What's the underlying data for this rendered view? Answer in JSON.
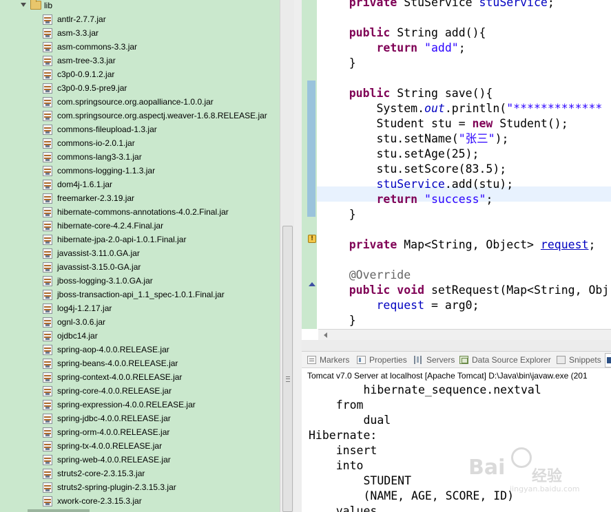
{
  "explorer": {
    "folder_label": "lib",
    "jars": [
      "antlr-2.7.7.jar",
      "asm-3.3.jar",
      "asm-commons-3.3.jar",
      "asm-tree-3.3.jar",
      "c3p0-0.9.1.2.jar",
      "c3p0-0.9.5-pre9.jar",
      "com.springsource.org.aopalliance-1.0.0.jar",
      "com.springsource.org.aspectj.weaver-1.6.8.RELEASE.jar",
      "commons-fileupload-1.3.jar",
      "commons-io-2.0.1.jar",
      "commons-lang3-3.1.jar",
      "commons-logging-1.1.3.jar",
      "dom4j-1.6.1.jar",
      "freemarker-2.3.19.jar",
      "hibernate-commons-annotations-4.0.2.Final.jar",
      "hibernate-core-4.2.4.Final.jar",
      "hibernate-jpa-2.0-api-1.0.1.Final.jar",
      "javassist-3.11.0.GA.jar",
      "javassist-3.15.0-GA.jar",
      "jboss-logging-3.1.0.GA.jar",
      "jboss-transaction-api_1.1_spec-1.0.1.Final.jar",
      "log4j-1.2.17.jar",
      "ognl-3.0.6.jar",
      "ojdbc14.jar",
      "spring-aop-4.0.0.RELEASE.jar",
      "spring-beans-4.0.0.RELEASE.jar",
      "spring-context-4.0.0.RELEASE.jar",
      "spring-core-4.0.0.RELEASE.jar",
      "spring-expression-4.0.0.RELEASE.jar",
      "spring-jdbc-4.0.0.RELEASE.jar",
      "spring-orm-4.0.0.RELEASE.jar",
      "spring-tx-4.0.0.RELEASE.jar",
      "spring-web-4.0.0.RELEASE.jar",
      "struts2-core-2.3.15.3.jar",
      "struts2-spring-plugin-2.3.15.3.jar",
      "xwork-core-2.3.15.3.jar"
    ]
  },
  "editor": {
    "lines": [
      [
        {
          "t": "    "
        },
        {
          "t": "private",
          "c": "kw"
        },
        {
          "t": " StuService "
        },
        {
          "t": "stuService",
          "c": "fld"
        },
        {
          "t": ";"
        }
      ],
      [],
      [
        {
          "t": "    "
        },
        {
          "t": "public",
          "c": "kw"
        },
        {
          "t": " String add(){"
        }
      ],
      [
        {
          "t": "        "
        },
        {
          "t": "return",
          "c": "kw"
        },
        {
          "t": " "
        },
        {
          "t": "\"add\"",
          "c": "str"
        },
        {
          "t": ";"
        }
      ],
      [
        {
          "t": "    }"
        }
      ],
      [],
      [
        {
          "t": "    "
        },
        {
          "t": "public",
          "c": "kw"
        },
        {
          "t": " String save(){"
        }
      ],
      [
        {
          "t": "        System."
        },
        {
          "t": "out",
          "c": "fld-i"
        },
        {
          "t": ".println("
        },
        {
          "t": "\"*************",
          "c": "str"
        }
      ],
      [
        {
          "t": "        Student stu = "
        },
        {
          "t": "new",
          "c": "kw"
        },
        {
          "t": " Student();"
        }
      ],
      [
        {
          "t": "        stu.setName("
        },
        {
          "t": "\"张三\"",
          "c": "str"
        },
        {
          "t": ");"
        }
      ],
      [
        {
          "t": "        stu.setAge(25);"
        }
      ],
      [
        {
          "t": "        stu.setScore(83.5);"
        }
      ],
      [
        {
          "t": "        "
        },
        {
          "t": "stuService",
          "c": "fld"
        },
        {
          "t": ".add(stu);"
        }
      ],
      [
        {
          "t": "        "
        },
        {
          "t": "return",
          "c": "kw"
        },
        {
          "t": " "
        },
        {
          "t": "\"success\"",
          "c": "str"
        },
        {
          "t": ";"
        }
      ],
      [
        {
          "t": "    }"
        }
      ],
      [],
      [
        {
          "t": "    "
        },
        {
          "t": "private",
          "c": "kw"
        },
        {
          "t": " Map<String, Object> "
        },
        {
          "t": "request",
          "c": "fld ul"
        },
        {
          "t": ";"
        }
      ],
      [],
      [
        {
          "t": "    "
        },
        {
          "t": "@Override",
          "c": "ann"
        }
      ],
      [
        {
          "t": "    "
        },
        {
          "t": "public",
          "c": "kw"
        },
        {
          "t": " "
        },
        {
          "t": "void",
          "c": "kw"
        },
        {
          "t": " setRequest(Map<String, Obj"
        }
      ],
      [
        {
          "t": "        "
        },
        {
          "t": "request",
          "c": "fld"
        },
        {
          "t": " = arg0;"
        }
      ],
      [
        {
          "t": "    }"
        }
      ]
    ]
  },
  "console": {
    "tabs": [
      "Markers",
      "Properties",
      "Servers",
      "Data Source Explorer",
      "Snippets"
    ],
    "title": "Tomcat v7.0 Server at localhost [Apache Tomcat] D:\\Java\\bin\\javaw.exe (201",
    "lines": [
      "        hibernate_sequence.nextval",
      "    from",
      "        dual",
      "Hibernate:",
      "    insert",
      "    into",
      "        STUDENT",
      "        (NAME, AGE, SCORE, ID)",
      "    values"
    ]
  },
  "watermark": {
    "brand": "Bai",
    "brand_sub": "经验",
    "url": "jingyan.baidu.com"
  }
}
